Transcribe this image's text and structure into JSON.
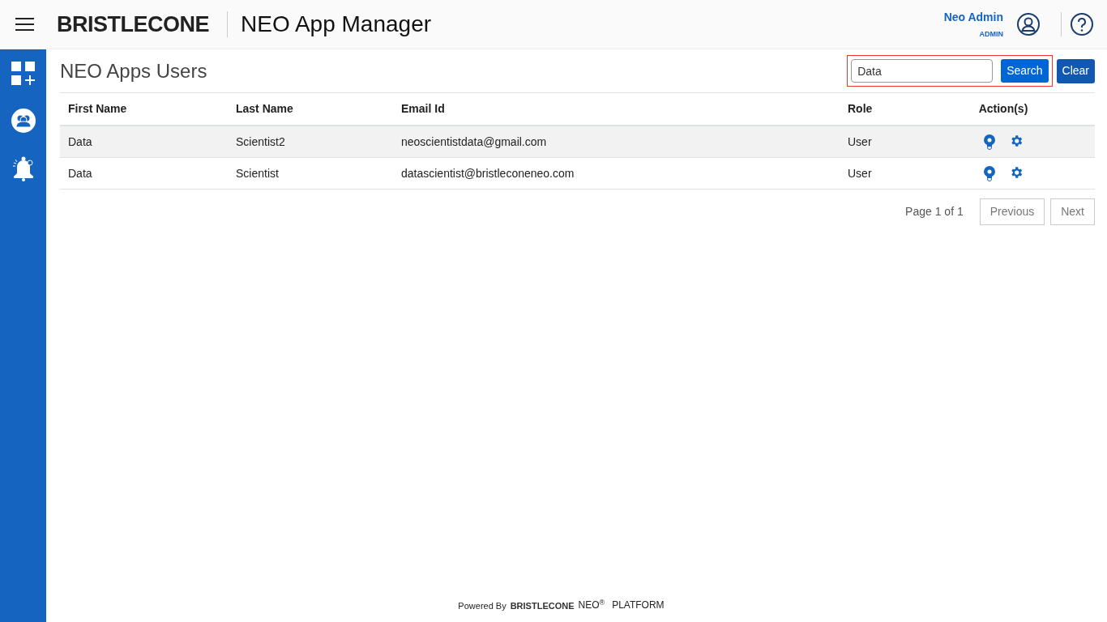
{
  "header": {
    "logo": "BRISTLECONE",
    "title": "NEO App Manager",
    "user": {
      "name": "Neo Admin",
      "role": "ADMIN"
    }
  },
  "sidebar": {
    "items": [
      {
        "kind": "apps"
      },
      {
        "kind": "users"
      },
      {
        "kind": "alerts"
      }
    ]
  },
  "page": {
    "title": "NEO Apps Users"
  },
  "search": {
    "value": "Data",
    "highlighted": true,
    "search_button": "Search",
    "clear_button": "Clear"
  },
  "table": {
    "columns": [
      "First Name",
      "Last Name",
      "Email Id",
      "Role",
      "Action(s)"
    ],
    "rows": [
      {
        "cells": [
          "Data",
          "Scientist2",
          "neoscientistdata@gmail.com",
          "User"
        ],
        "selected": true
      },
      {
        "cells": [
          "Data",
          "Scientist",
          "datascientist@bristleconeneo.com",
          "User"
        ],
        "selected": false
      }
    ]
  },
  "pagination": {
    "label": "Page 1 of 1",
    "previous": "Previous",
    "next": "Next"
  },
  "footer": {
    "powered_by": "Powered By",
    "logo": "BRISTLECONE",
    "product": "NEO$^{®}$",
    "platform": "PLATFORM"
  }
}
